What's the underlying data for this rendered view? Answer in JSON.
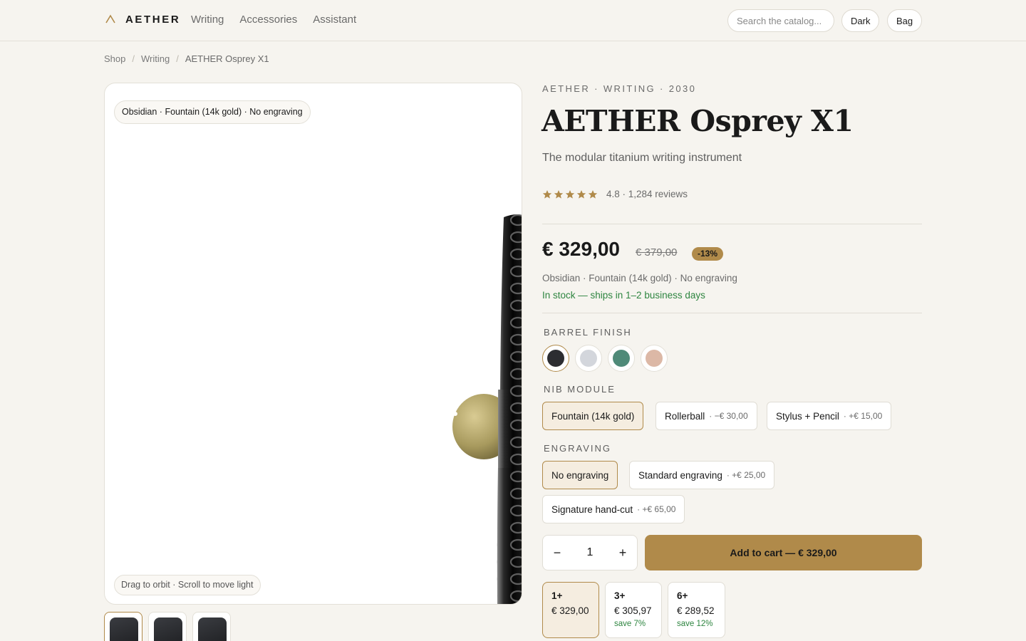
{
  "header": {
    "brand": "AETHER",
    "nav": [
      "Writing",
      "Accessories",
      "Assistant"
    ],
    "search_placeholder": "Search the catalog...",
    "theme_label": "Dark",
    "bag_label": "Bag"
  },
  "breadcrumb": [
    "Shop",
    "Writing",
    "AETHER Osprey X1"
  ],
  "viewer": {
    "config_chip": "Obsidian · Fountain (14k gold) · No engraving",
    "hint": "Drag to orbit · Scroll to move light"
  },
  "product": {
    "eyebrow": "AETHER · WRITING · 2030",
    "title": "AETHER Osprey X1",
    "subtitle": "The modular titanium writing instrument",
    "rating": 4.8,
    "rating_text": "4.8 · 1,284 reviews",
    "price": "€ 329,00",
    "old_price": "€ 379,00",
    "discount": "-13%",
    "config_line": "Obsidian · Fountain (14k gold) · No engraving",
    "stock": "In stock — ships in 1–2 business days",
    "accent_color": "#b08a4a",
    "stock_color": "#2e8540"
  },
  "options": {
    "finish_label": "BARREL FINISH",
    "finishes": [
      {
        "name": "Obsidian",
        "color": "#2c2d31",
        "selected": true
      },
      {
        "name": "Silver",
        "color": "#d3d6dc",
        "selected": false
      },
      {
        "name": "Verdigris",
        "color": "#4f8a78",
        "selected": false
      },
      {
        "name": "Rose",
        "color": "#dcb8a6",
        "selected": false
      }
    ],
    "nib_label": "NIB MODULE",
    "nibs": [
      {
        "label": "Fountain (14k gold)",
        "delta": "",
        "selected": true
      },
      {
        "label": "Rollerball",
        "delta": "· −€ 30,00",
        "selected": false
      },
      {
        "label": "Stylus + Pencil",
        "delta": "· +€ 15,00",
        "selected": false
      }
    ],
    "engraving_label": "ENGRAVING",
    "engravings": [
      {
        "label": "No engraving",
        "delta": "",
        "selected": true
      },
      {
        "label": "Standard engraving",
        "delta": "· +€ 25,00",
        "selected": false
      },
      {
        "label": "Signature hand-cut",
        "delta": "· +€ 65,00",
        "selected": false
      }
    ]
  },
  "purchase": {
    "quantity": "1",
    "minus": "−",
    "plus": "+",
    "cart_label": "Add to cart — € 329,00"
  },
  "tiers": [
    {
      "qty": "1+",
      "price": "€ 329,00",
      "save": "",
      "selected": true
    },
    {
      "qty": "3+",
      "price": "€ 305,97",
      "save": "save 7%",
      "selected": false
    },
    {
      "qty": "6+",
      "price": "€ 289,52",
      "save": "save 12%",
      "selected": false
    }
  ]
}
